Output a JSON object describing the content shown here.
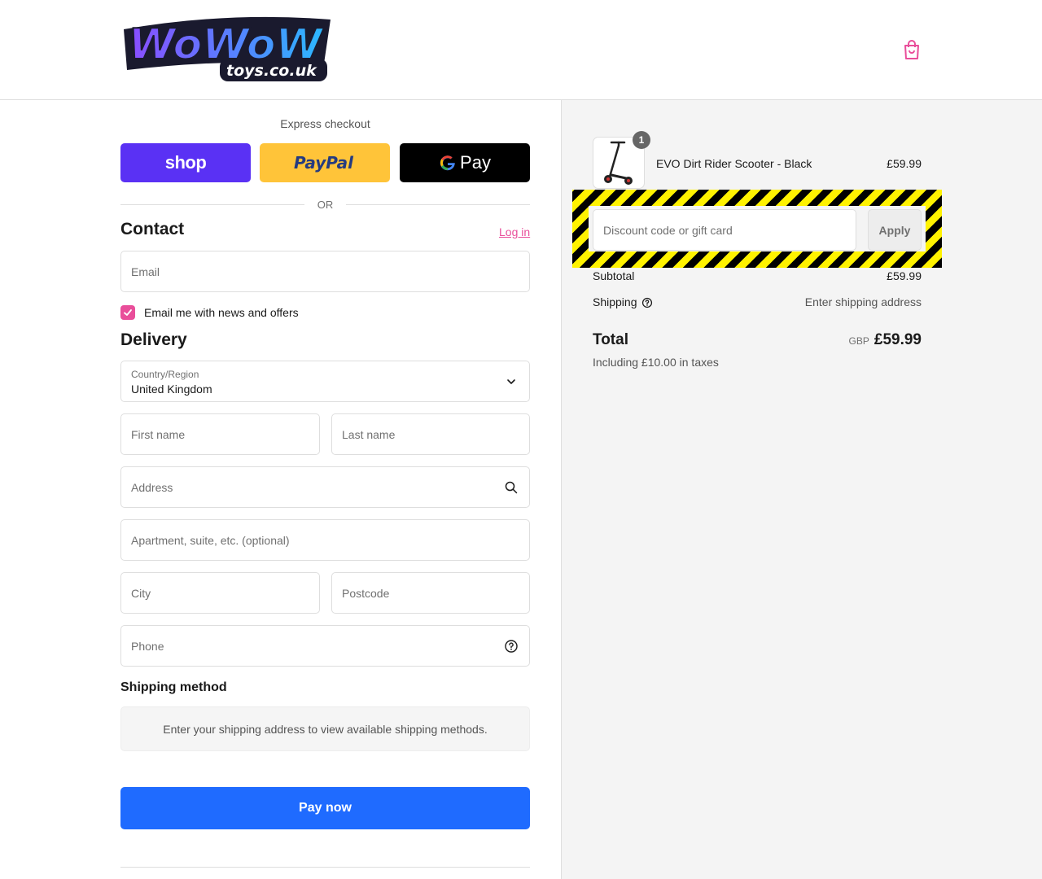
{
  "header": {
    "logo_main": "WoWoW",
    "logo_sub": "toys.co.uk",
    "cart_icon": "shopping-bag-icon"
  },
  "express": {
    "title": "Express checkout",
    "shop_label": "shop",
    "paypal_label": "PayPal",
    "gpay_label": "Pay",
    "or_label": "OR"
  },
  "contact": {
    "title": "Contact",
    "login_label": "Log in",
    "email_placeholder": "Email",
    "newsletter_label": "Email me with news and offers",
    "newsletter_checked": true
  },
  "delivery": {
    "title": "Delivery",
    "country_label": "Country/Region",
    "country_value": "United Kingdom",
    "first_name_placeholder": "First name",
    "last_name_placeholder": "Last name",
    "address_placeholder": "Address",
    "apartment_placeholder": "Apartment, suite, etc. (optional)",
    "city_placeholder": "City",
    "postcode_placeholder": "Postcode",
    "phone_placeholder": "Phone"
  },
  "shipping_method": {
    "title": "Shipping method",
    "message": "Enter your shipping address to view available shipping methods."
  },
  "pay_now_label": "Pay now",
  "order": {
    "product_name": "EVO Dirt Rider Scooter - Black",
    "product_price": "£59.99",
    "quantity": "1",
    "discount_placeholder": "Discount code or gift card",
    "apply_label": "Apply",
    "subtotal_label": "Subtotal",
    "subtotal_value": "£59.99",
    "shipping_label": "Shipping",
    "shipping_value": "Enter shipping address",
    "total_label": "Total",
    "total_currency": "GBP",
    "total_value": "£59.99",
    "taxes_note": "Including £10.00 in taxes"
  },
  "colors": {
    "accent_pink": "#e94e9a",
    "pay_button_blue": "#1f6bff",
    "shop_purple": "#5a31f4",
    "paypal_yellow": "#ffc439"
  }
}
